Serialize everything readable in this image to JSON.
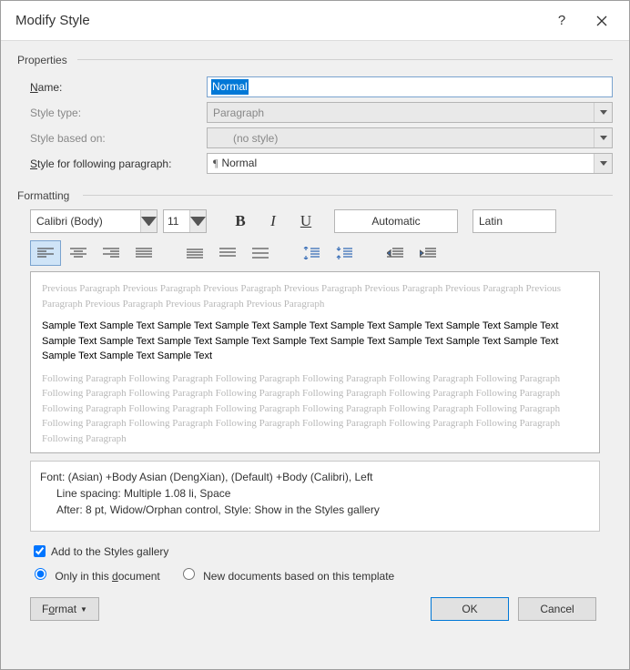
{
  "title": "Modify Style",
  "sections": {
    "properties": "Properties",
    "formatting": "Formatting"
  },
  "props": {
    "name_label": "Name:",
    "name_value": "Normal",
    "type_label": "Style type:",
    "type_value": "Paragraph",
    "based_label": "Style based on:",
    "based_value": "(no style)",
    "following_label": "Style for following paragraph:",
    "following_value": "Normal"
  },
  "formatting": {
    "font": "Calibri (Body)",
    "size": "11",
    "bold": "B",
    "italic": "I",
    "underline": "U",
    "color": "Automatic",
    "language": "Latin"
  },
  "preview": {
    "prev": "Previous Paragraph Previous Paragraph Previous Paragraph Previous Paragraph Previous Paragraph Previous Paragraph Previous Paragraph Previous Paragraph Previous Paragraph Previous Paragraph",
    "sample": "Sample Text Sample Text Sample Text Sample Text Sample Text Sample Text Sample Text Sample Text Sample Text Sample Text Sample Text Sample Text Sample Text Sample Text Sample Text Sample Text Sample Text Sample Text Sample Text Sample Text Sample Text",
    "foll": "Following Paragraph Following Paragraph Following Paragraph Following Paragraph Following Paragraph Following Paragraph Following Paragraph Following Paragraph Following Paragraph Following Paragraph Following Paragraph Following Paragraph Following Paragraph Following Paragraph Following Paragraph Following Paragraph Following Paragraph Following Paragraph Following Paragraph Following Paragraph Following Paragraph Following Paragraph Following Paragraph Following Paragraph Following Paragraph"
  },
  "description": {
    "line1": "Font: (Asian) +Body Asian (DengXian), (Default) +Body (Calibri), Left",
    "line2": "Line spacing:  Multiple 1.08 li, Space",
    "line3": "After:  8 pt, Widow/Orphan control, Style: Show in the Styles gallery"
  },
  "options": {
    "add_gallery": "Add to the Styles gallery",
    "only_doc": "Only in this document",
    "new_docs": "New documents based on this template"
  },
  "buttons": {
    "format": "Format",
    "ok": "OK",
    "cancel": "Cancel"
  }
}
